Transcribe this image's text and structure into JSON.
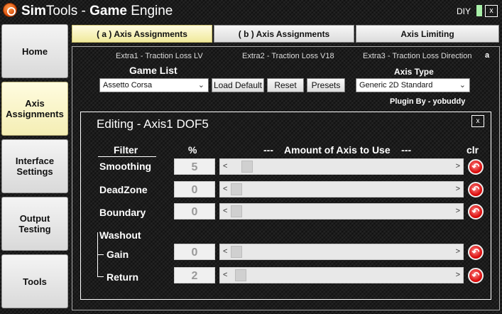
{
  "app": {
    "title_prefix": "Sim",
    "title_mid": "Tools - ",
    "title_bold": "Game",
    "title_suffix": " Engine",
    "diy": "DIY",
    "close": "x"
  },
  "nav": {
    "home": "Home",
    "axis": "Axis\nAssignments",
    "interface": "Interface\nSettings",
    "output": "Output\nTesting",
    "tools": "Tools"
  },
  "tabs": {
    "a": "( a ) Axis Assignments",
    "b": "( b ) Axis Assignments",
    "limiting": "Axis Limiting"
  },
  "extras": {
    "extra1": "Extra1 - Traction Loss LV",
    "extra2": "Extra2 - Traction Loss V18",
    "extra3": "Extra3 - Traction Loss Direction",
    "corner": "a"
  },
  "game_list": {
    "label": "Game List",
    "value": "Assetto Corsa"
  },
  "buttons": {
    "load_default": "Load Default",
    "reset": "Reset",
    "presets": "Presets"
  },
  "axis_type": {
    "label": "Axis Type",
    "value": "Generic 2D Standard"
  },
  "plugin": "Plugin By - yobuddy",
  "editing": {
    "title": "Editing - Axis1 DOF5",
    "close": "x",
    "headers": {
      "filter": "Filter",
      "pct": "%",
      "amount": "---    Amount of Axis to Use    ---",
      "clr": "clr"
    },
    "washout": "Washout",
    "rows": [
      {
        "label": "Smoothing",
        "value": "5",
        "level": 0.05
      },
      {
        "label": "DeadZone",
        "value": "0",
        "level": 0.0
      },
      {
        "label": "Boundary",
        "value": "0",
        "level": 0.0
      },
      {
        "label": "Gain",
        "value": "0",
        "level": 0.0
      },
      {
        "label": "Return",
        "value": "2",
        "level": 0.02
      }
    ]
  }
}
